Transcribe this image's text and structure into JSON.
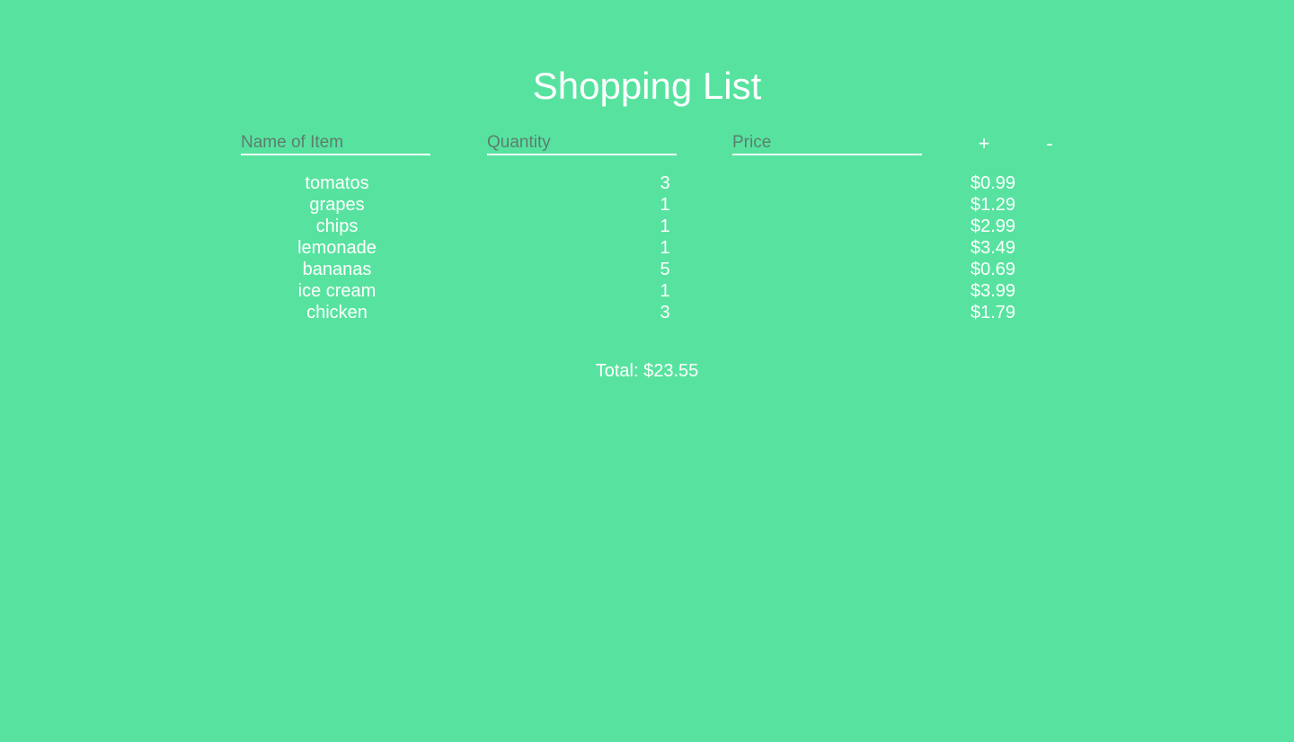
{
  "page": {
    "title": "Shopping List"
  },
  "form": {
    "name_placeholder": "Name of Item",
    "quantity_placeholder": "Quantity",
    "price_placeholder": "Price",
    "add_label": "+",
    "remove_label": "-"
  },
  "items": [
    {
      "name": "tomatos",
      "quantity": "3",
      "price": "$0.99"
    },
    {
      "name": "grapes",
      "quantity": "1",
      "price": "$1.29"
    },
    {
      "name": "chips",
      "quantity": "1",
      "price": "$2.99"
    },
    {
      "name": "lemonade",
      "quantity": "1",
      "price": "$3.49"
    },
    {
      "name": "bananas",
      "quantity": "5",
      "price": "$0.69"
    },
    {
      "name": "ice cream",
      "quantity": "1",
      "price": "$3.99"
    },
    {
      "name": "chicken",
      "quantity": "3",
      "price": "$1.79"
    }
  ],
  "summary": {
    "total_label": "Total: $23.55"
  },
  "colors": {
    "background": "#57e39f",
    "text": "#ffffff",
    "placeholder": "#5e7d6e"
  }
}
